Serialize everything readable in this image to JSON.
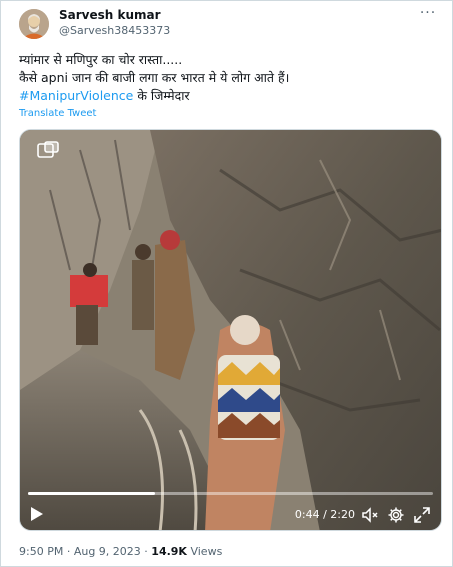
{
  "tweet": {
    "author_name": "Sarvesh kumar",
    "author_handle": "@Sarvesh38453373",
    "line1": "म्यांमार से मणिपुर का चोर रास्ता.....",
    "line2": "कैसे apni जान की बाजी लगा कर भारत मे ये लोग आते हैं।",
    "hashtag": "#ManipurViolence",
    "line3_rest": " के जिम्मेदार",
    "translate_label": "Translate Tweet",
    "more_label": "···"
  },
  "video": {
    "elapsed": "0:44",
    "duration": "2:20",
    "time_separator": " / ",
    "progress_fraction": 0.314
  },
  "meta": {
    "time": "9:50 PM",
    "separator": " · ",
    "date": "Aug 9, 2023",
    "views_count": "14.9K",
    "views_label": " Views"
  },
  "icons": {
    "more": "more-dots-icon",
    "pip": "picture-in-picture-icon",
    "play": "play-icon",
    "volume": "volume-muted-icon",
    "settings": "gear-icon",
    "fullscreen": "fullscreen-icon"
  },
  "colors": {
    "link": "#1d9bf0",
    "secondary_text": "#536471",
    "primary_text": "#0f1419",
    "border": "#cfd9de"
  }
}
